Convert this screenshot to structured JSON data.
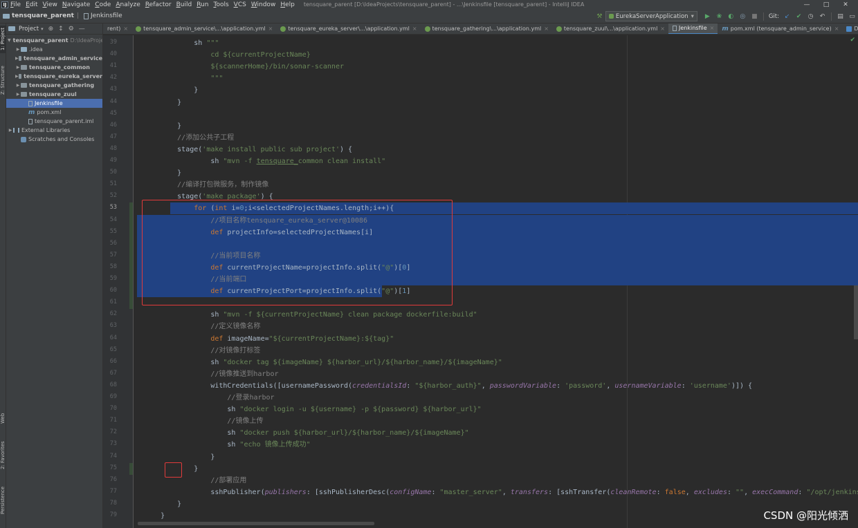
{
  "menubar": {
    "items": [
      "File",
      "Edit",
      "View",
      "Navigate",
      "Code",
      "Analyze",
      "Refactor",
      "Build",
      "Run",
      "Tools",
      "VCS",
      "Window",
      "Help"
    ],
    "window_title": "tensquare_parent [D:\\IdeaProjects\\tensquare_parent] - ...\\Jenkinsfile [tensquare_parent] - IntelliJ IDEA",
    "min": "—",
    "max": "□",
    "close": "✕"
  },
  "navbar": {
    "project": "tensquare_parent",
    "file": "Jenkinsfile",
    "run_config": "EurekaServerApplication",
    "git_label": "Git:"
  },
  "left_strip": {
    "project_tab": "1: Project",
    "structure_tab": "Z: Structure",
    "web_tab": "Web",
    "favorites_tab": "2: Favorites",
    "persistence_tab": "Persistence"
  },
  "project_panel": {
    "title": "Project",
    "tree": [
      {
        "label": "tensquare_parent",
        "path": "D:\\IdeaProjects",
        "icon": "module-folder-icon",
        "indent": 0,
        "arrow": "open",
        "bold": true
      },
      {
        "label": ".idea",
        "icon": "folder-icon",
        "indent": 1,
        "arrow": "closed",
        "bold": false
      },
      {
        "label": "tensquare_admin_service",
        "icon": "module-folder-icon",
        "indent": 1,
        "arrow": "closed",
        "bold": true
      },
      {
        "label": "tensquare_common",
        "icon": "module-folder-icon",
        "indent": 1,
        "arrow": "closed",
        "bold": true
      },
      {
        "label": "tensquare_eureka_server",
        "icon": "module-folder-icon",
        "indent": 1,
        "arrow": "closed",
        "bold": true
      },
      {
        "label": "tensquare_gathering",
        "icon": "module-folder-icon",
        "indent": 1,
        "arrow": "closed",
        "bold": true
      },
      {
        "label": "tensquare_zuul",
        "icon": "module-folder-icon",
        "indent": 1,
        "arrow": "closed",
        "bold": true
      },
      {
        "label": "Jenkinsfile",
        "icon": "file-icon",
        "indent": 2,
        "arrow": "none",
        "bold": false,
        "selected": true
      },
      {
        "label": "pom.xml",
        "icon": "maven-icon",
        "indent": 2,
        "arrow": "none",
        "bold": false
      },
      {
        "label": "tensquare_parent.iml",
        "icon": "file-icon",
        "indent": 2,
        "arrow": "none",
        "bold": false
      },
      {
        "label": "External Libraries",
        "icon": "library-icon",
        "indent": 0,
        "arrow": "closed",
        "bold": false
      },
      {
        "label": "Scratches and Consoles",
        "icon": "scratch-icon",
        "indent": 1,
        "arrow": "none",
        "bold": false
      }
    ]
  },
  "editor_tabs": [
    {
      "label": "rent)",
      "icon": "none"
    },
    {
      "label": "tensquare_admin_service\\...\\application.yml",
      "icon": "yml-icon"
    },
    {
      "label": "tensquare_eureka_server\\...\\application.yml",
      "icon": "yml-icon"
    },
    {
      "label": "tensquare_gathering\\...\\application.yml",
      "icon": "yml-icon"
    },
    {
      "label": "tensquare_zuul\\...\\application.yml",
      "icon": "yml-icon"
    },
    {
      "label": "Jenkinsfile",
      "icon": "jenkinsfile-icon",
      "active": true
    },
    {
      "label": "pom.xml (tensquare_admin_service)",
      "icon": "maven-icon"
    },
    {
      "label": "Dockerfi",
      "icon": "docker-icon"
    }
  ],
  "code": {
    "line_numbers": [
      39,
      40,
      41,
      42,
      43,
      44,
      45,
      46,
      47,
      48,
      49,
      50,
      51,
      52,
      53,
      54,
      55,
      56,
      57,
      58,
      59,
      60,
      61,
      62,
      63,
      64,
      65,
      66,
      67,
      68,
      69,
      70,
      71,
      72,
      73,
      74,
      75,
      76,
      77,
      78,
      79
    ],
    "lines": [
      [
        {
          "t": "            sh ",
          "c": ""
        },
        {
          "t": "\"\"\"",
          "c": "str"
        }
      ],
      [
        {
          "t": "                cd ${currentProjectName}",
          "c": "str"
        }
      ],
      [
        {
          "t": "                ${scannerHome}/bin/sonar-scanner",
          "c": "str"
        }
      ],
      [
        {
          "t": "                \"\"\"",
          "c": "str"
        }
      ],
      [
        {
          "t": "            }",
          "c": ""
        }
      ],
      [
        {
          "t": "        }",
          "c": ""
        }
      ],
      [
        {
          "t": "",
          "c": ""
        }
      ],
      [
        {
          "t": "        }",
          "c": ""
        }
      ],
      [
        {
          "t": "        //添加公共子工程",
          "c": "cmt"
        }
      ],
      [
        {
          "t": "        stage(",
          "c": ""
        },
        {
          "t": "'make install public sub project'",
          "c": "str"
        },
        {
          "t": ") {",
          "c": ""
        }
      ],
      [
        {
          "t": "                sh ",
          "c": ""
        },
        {
          "t": "\"mvn -f ",
          "c": "str"
        },
        {
          "t": "tensquare_",
          "c": "str und"
        },
        {
          "t": "common clean install\"",
          "c": "str"
        }
      ],
      [
        {
          "t": "        }",
          "c": ""
        }
      ],
      [
        {
          "t": "        //编译打包微服务，制作镜像",
          "c": "cmt"
        }
      ],
      [
        {
          "t": "        stage(",
          "c": ""
        },
        {
          "t": "'make package'",
          "c": "str"
        },
        {
          "t": ") {",
          "c": ""
        }
      ],
      [
        {
          "t": "            ",
          "c": ""
        },
        {
          "t": "for",
          "c": "kw"
        },
        {
          "t": " (",
          "c": ""
        },
        {
          "t": "int",
          "c": "kw"
        },
        {
          "t": " i=",
          "c": ""
        },
        {
          "t": "0",
          "c": "num"
        },
        {
          "t": ";i<selectedProjectNames.length;i++){",
          "c": ""
        }
      ],
      [
        {
          "t": "                //项目名称tensquare_eureka_server@10086",
          "c": "cmt"
        }
      ],
      [
        {
          "t": "                ",
          "c": ""
        },
        {
          "t": "def",
          "c": "kw"
        },
        {
          "t": " projectInfo=selectedProjectNames[i]",
          "c": ""
        }
      ],
      [
        {
          "t": "",
          "c": ""
        }
      ],
      [
        {
          "t": "                //当前项目名称",
          "c": "cmt"
        }
      ],
      [
        {
          "t": "                ",
          "c": ""
        },
        {
          "t": "def",
          "c": "kw"
        },
        {
          "t": " currentProjectName=projectInfo.split(",
          "c": ""
        },
        {
          "t": "\"@\"",
          "c": "str"
        },
        {
          "t": ")[",
          "c": ""
        },
        {
          "t": "0",
          "c": "num"
        },
        {
          "t": "]",
          "c": ""
        }
      ],
      [
        {
          "t": "                //当前端口",
          "c": "cmt"
        }
      ],
      [
        {
          "t": "                ",
          "c": ""
        },
        {
          "t": "def",
          "c": "kw"
        },
        {
          "t": " currentProjectPort=projectInfo.split(",
          "c": ""
        },
        {
          "t": "\"@\"",
          "c": "str"
        },
        {
          "t": ")[",
          "c": ""
        },
        {
          "t": "1",
          "c": "num"
        },
        {
          "t": "]",
          "c": ""
        }
      ],
      [
        {
          "t": "",
          "c": ""
        }
      ],
      [
        {
          "t": "                sh ",
          "c": ""
        },
        {
          "t": "\"mvn -f ${currentProjectName} clean package dockerfile:build\"",
          "c": "str"
        }
      ],
      [
        {
          "t": "                //定义镜像名称",
          "c": "cmt"
        }
      ],
      [
        {
          "t": "                ",
          "c": ""
        },
        {
          "t": "def",
          "c": "kw"
        },
        {
          "t": " imageName=",
          "c": ""
        },
        {
          "t": "\"${currentProjectName}:${tag}\"",
          "c": "str"
        }
      ],
      [
        {
          "t": "                //对镜像打标签",
          "c": "cmt"
        }
      ],
      [
        {
          "t": "                sh ",
          "c": ""
        },
        {
          "t": "\"docker tag ${imageName} ${harbor_url}/${harbor_name}/${imageName}\"",
          "c": "str"
        }
      ],
      [
        {
          "t": "                //镜像推送到harbor",
          "c": "cmt"
        }
      ],
      [
        {
          "t": "                withCredentials([usernamePassword(",
          "c": ""
        },
        {
          "t": "credentialsId",
          "c": "prm"
        },
        {
          "t": ": ",
          "c": ""
        },
        {
          "t": "\"${harbor_auth}\"",
          "c": "str"
        },
        {
          "t": ", ",
          "c": ""
        },
        {
          "t": "passwordVariable",
          "c": "prm"
        },
        {
          "t": ": ",
          "c": ""
        },
        {
          "t": "'password'",
          "c": "str"
        },
        {
          "t": ", ",
          "c": ""
        },
        {
          "t": "usernameVariable",
          "c": "prm"
        },
        {
          "t": ": ",
          "c": ""
        },
        {
          "t": "'username'",
          "c": "str"
        },
        {
          "t": ")]) {",
          "c": ""
        }
      ],
      [
        {
          "t": "                    //登录harbor",
          "c": "cmt"
        }
      ],
      [
        {
          "t": "                    sh ",
          "c": ""
        },
        {
          "t": "\"docker login -u ${username} -p ${password} ${harbor_url}\"",
          "c": "str"
        }
      ],
      [
        {
          "t": "                    //镜像上传",
          "c": "cmt"
        }
      ],
      [
        {
          "t": "                    sh ",
          "c": ""
        },
        {
          "t": "\"docker push ${harbor_url}/${harbor_name}/${imageName}\"",
          "c": "str"
        }
      ],
      [
        {
          "t": "                    sh ",
          "c": ""
        },
        {
          "t": "\"echo 镜像上传成功\"",
          "c": "str"
        }
      ],
      [
        {
          "t": "                }",
          "c": ""
        }
      ],
      [
        {
          "t": "            }",
          "c": ""
        }
      ],
      [
        {
          "t": "                //部署应用",
          "c": "cmt"
        }
      ],
      [
        {
          "t": "                sshPublisher(",
          "c": ""
        },
        {
          "t": "publishers",
          "c": "prm"
        },
        {
          "t": ": [sshPublisherDesc(",
          "c": ""
        },
        {
          "t": "configName",
          "c": "prm"
        },
        {
          "t": ": ",
          "c": ""
        },
        {
          "t": "\"master_server\"",
          "c": "str"
        },
        {
          "t": ", ",
          "c": ""
        },
        {
          "t": "transfers",
          "c": "prm"
        },
        {
          "t": ": [sshTransfer(",
          "c": ""
        },
        {
          "t": "cleanRemote",
          "c": "prm"
        },
        {
          "t": ": ",
          "c": ""
        },
        {
          "t": "false",
          "c": "kw"
        },
        {
          "t": ", ",
          "c": ""
        },
        {
          "t": "excludes",
          "c": "prm"
        },
        {
          "t": ": ",
          "c": ""
        },
        {
          "t": "\"\"",
          "c": "str"
        },
        {
          "t": ", ",
          "c": ""
        },
        {
          "t": "execCommand",
          "c": "prm"
        },
        {
          "t": ": ",
          "c": ""
        },
        {
          "t": "\"/opt/jenkins_shell/de",
          "c": "str"
        }
      ],
      [
        {
          "t": "        }",
          "c": ""
        }
      ],
      [
        {
          "t": "    }",
          "c": ""
        }
      ]
    ]
  },
  "watermark": "CSDN @阳光倾洒",
  "colors": {
    "selection": "#214283",
    "annotation_box": "#e23b3b",
    "keyword": "#cc7832",
    "string": "#6a8759",
    "comment": "#808080"
  }
}
